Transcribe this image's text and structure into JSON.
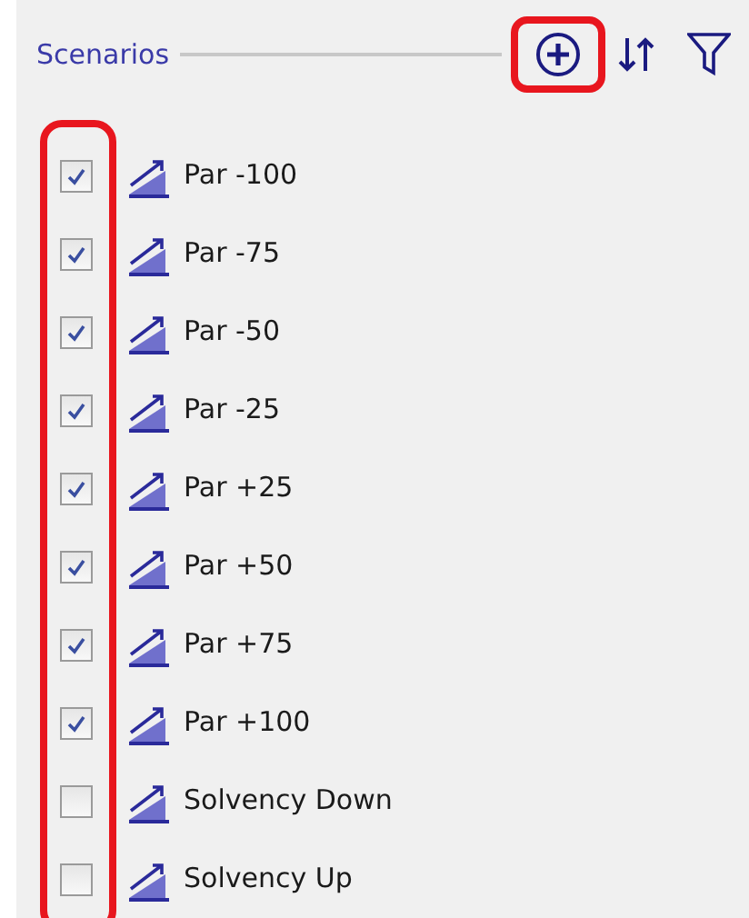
{
  "panel": {
    "title": "Scenarios"
  },
  "scenarios": [
    {
      "label": "Par -100",
      "checked": true
    },
    {
      "label": "Par -75",
      "checked": true
    },
    {
      "label": "Par -50",
      "checked": true
    },
    {
      "label": "Par -25",
      "checked": true
    },
    {
      "label": "Par +25",
      "checked": true
    },
    {
      "label": "Par +50",
      "checked": true
    },
    {
      "label": "Par +75",
      "checked": true
    },
    {
      "label": "Par +100",
      "checked": true
    },
    {
      "label": "Solvency Down",
      "checked": false
    },
    {
      "label": "Solvency Up",
      "checked": false
    }
  ]
}
